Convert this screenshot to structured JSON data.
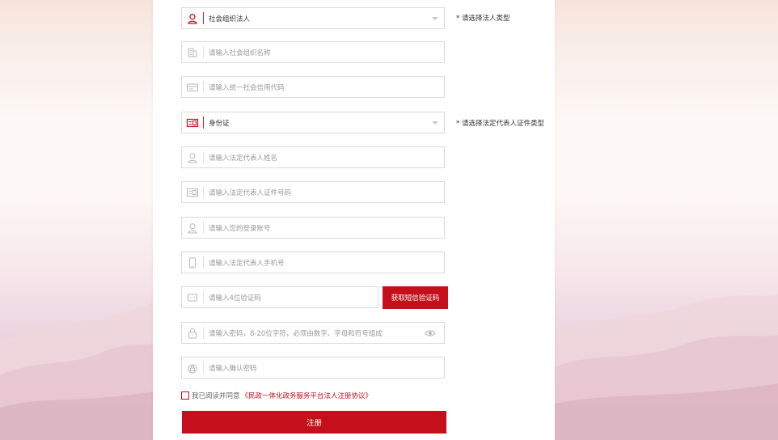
{
  "form": {
    "entity_type": {
      "value": "社会组织法人",
      "hint": "* 请选择法人类型"
    },
    "org_name": {
      "placeholder": "请输入社会组织名称"
    },
    "credit_code": {
      "placeholder": "请输入统一社会信用代码"
    },
    "id_type": {
      "value": "身份证",
      "hint": "* 请选择法定代表人证件类型"
    },
    "rep_name": {
      "placeholder": "请输入法定代表人姓名"
    },
    "rep_id": {
      "placeholder": "请输入法定代表人证件号码"
    },
    "login_account": {
      "placeholder": "请输入您的登录账号"
    },
    "rep_phone": {
      "placeholder": "请输入法定代表人手机号"
    },
    "sms_code": {
      "placeholder": "请输入4位验证码",
      "button": "获取短信验证码"
    },
    "password": {
      "placeholder": "请输入密码，8-20位字符，必须由数字、字母和符号组成"
    },
    "confirm_password": {
      "placeholder": "请输入确认密码"
    },
    "agreement": {
      "prefix": "我已阅读并同意",
      "link": "《民政一体化政务服务平台法人注册协议》"
    },
    "submit_label": "注册"
  },
  "colors": {
    "primary": "#c5101c",
    "border": "#dcdcdc",
    "placeholder": "#999999"
  },
  "icons": [
    "user-icon",
    "building-icon",
    "card-icon",
    "id-card-icon",
    "phone-icon",
    "sms-icon",
    "lock-icon",
    "eye-icon"
  ]
}
